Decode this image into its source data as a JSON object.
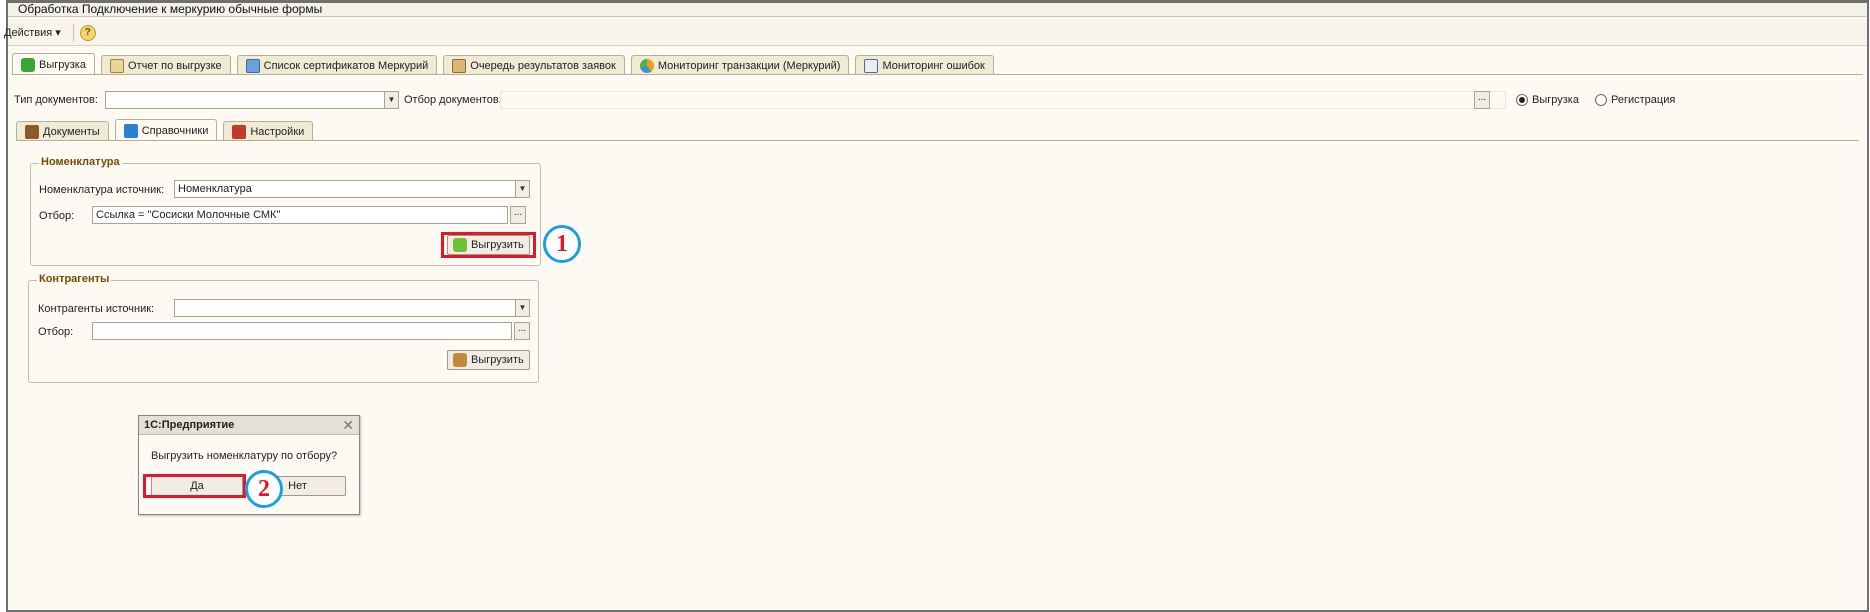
{
  "window": {
    "title": "Обработка  Подключение к меркурию обычные формы"
  },
  "menubar": {
    "actions_label": "Действия",
    "help_symbol": "?"
  },
  "top_tabs": [
    {
      "label": "Выгрузка",
      "icon": "upload-icon",
      "color": "#3aa63a"
    },
    {
      "label": "Отчет по выгрузке",
      "icon": "report-icon",
      "color": "#c9a04a"
    },
    {
      "label": "Список сертификатов Меркурий",
      "icon": "certificate-list-icon",
      "color": "#4a7fc9"
    },
    {
      "label": "Очередь результатов заявок",
      "icon": "queue-icon",
      "color": "#a0763a"
    },
    {
      "label": "Мониторинг транзакции (Меркурий)",
      "icon": "pie-chart-icon",
      "color": "#e6a020"
    },
    {
      "label": "Мониторинг ошибок",
      "icon": "monitor-icon",
      "color": "#c0392b"
    }
  ],
  "filters": {
    "doc_type_label": "Тип документов:",
    "doc_type_value": "",
    "doc_filter_label": "Отбор документов:",
    "doc_filter_value": "",
    "dots": "...",
    "radio_upload": "Выгрузка",
    "radio_register": "Регистрация",
    "selected_radio": "Выгрузка"
  },
  "sub_tabs": [
    {
      "label": "Документы",
      "icon": "briefcase-icon",
      "color": "#8a5a2b"
    },
    {
      "label": "Справочники",
      "icon": "directory-icon",
      "color": "#2b7fd0"
    },
    {
      "label": "Настройки",
      "icon": "settings-icon",
      "color": "#c0392b"
    }
  ],
  "nomenclature": {
    "title": "Номенклатура",
    "source_label": "Номенклатура источник:",
    "source_value": "Номенклатура",
    "filter_label": "Отбор:",
    "filter_value": "Ссылка = \"Сосиски Молочные СМК\"",
    "button_label": "Выгрузить"
  },
  "contractors": {
    "title": "Контрагенты",
    "source_label": "Контрагенты источник:",
    "source_value": "",
    "filter_label": "Отбор:",
    "filter_value": "",
    "button_label": "Выгрузить"
  },
  "callouts": {
    "first": "1",
    "second": "2"
  },
  "dialog": {
    "title": "1С:Предприятие",
    "message": "Выгрузить номенклатуру по отбору?",
    "yes_label": "Да",
    "no_label": "Нет"
  },
  "colors": {
    "highlight": "#e0182b",
    "callout_ring": "#1ba0de",
    "group_title": "#7b4a00"
  }
}
